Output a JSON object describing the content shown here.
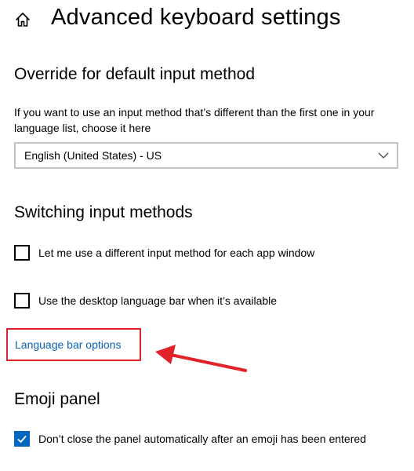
{
  "header": {
    "title": "Advanced keyboard settings",
    "home_icon": "home-icon"
  },
  "override": {
    "heading": "Override for default input method",
    "description": "If you want to use an input method that’s different than the first one in your language list, choose it here",
    "selected_value": "English (United States) - US"
  },
  "switching": {
    "heading": "Switching input methods",
    "options": [
      {
        "label": "Let me use a different input method for each app window",
        "checked": false
      },
      {
        "label": "Use the desktop language bar when it’s available",
        "checked": false
      }
    ],
    "link_label": "Language bar options"
  },
  "emoji": {
    "heading": "Emoji panel",
    "option": {
      "label": "Don’t close the panel automatically after an emoji has been entered",
      "checked": true
    }
  },
  "colors": {
    "accent": "#0067c0",
    "link": "#0a62b0",
    "annotation": "#e0242a"
  }
}
